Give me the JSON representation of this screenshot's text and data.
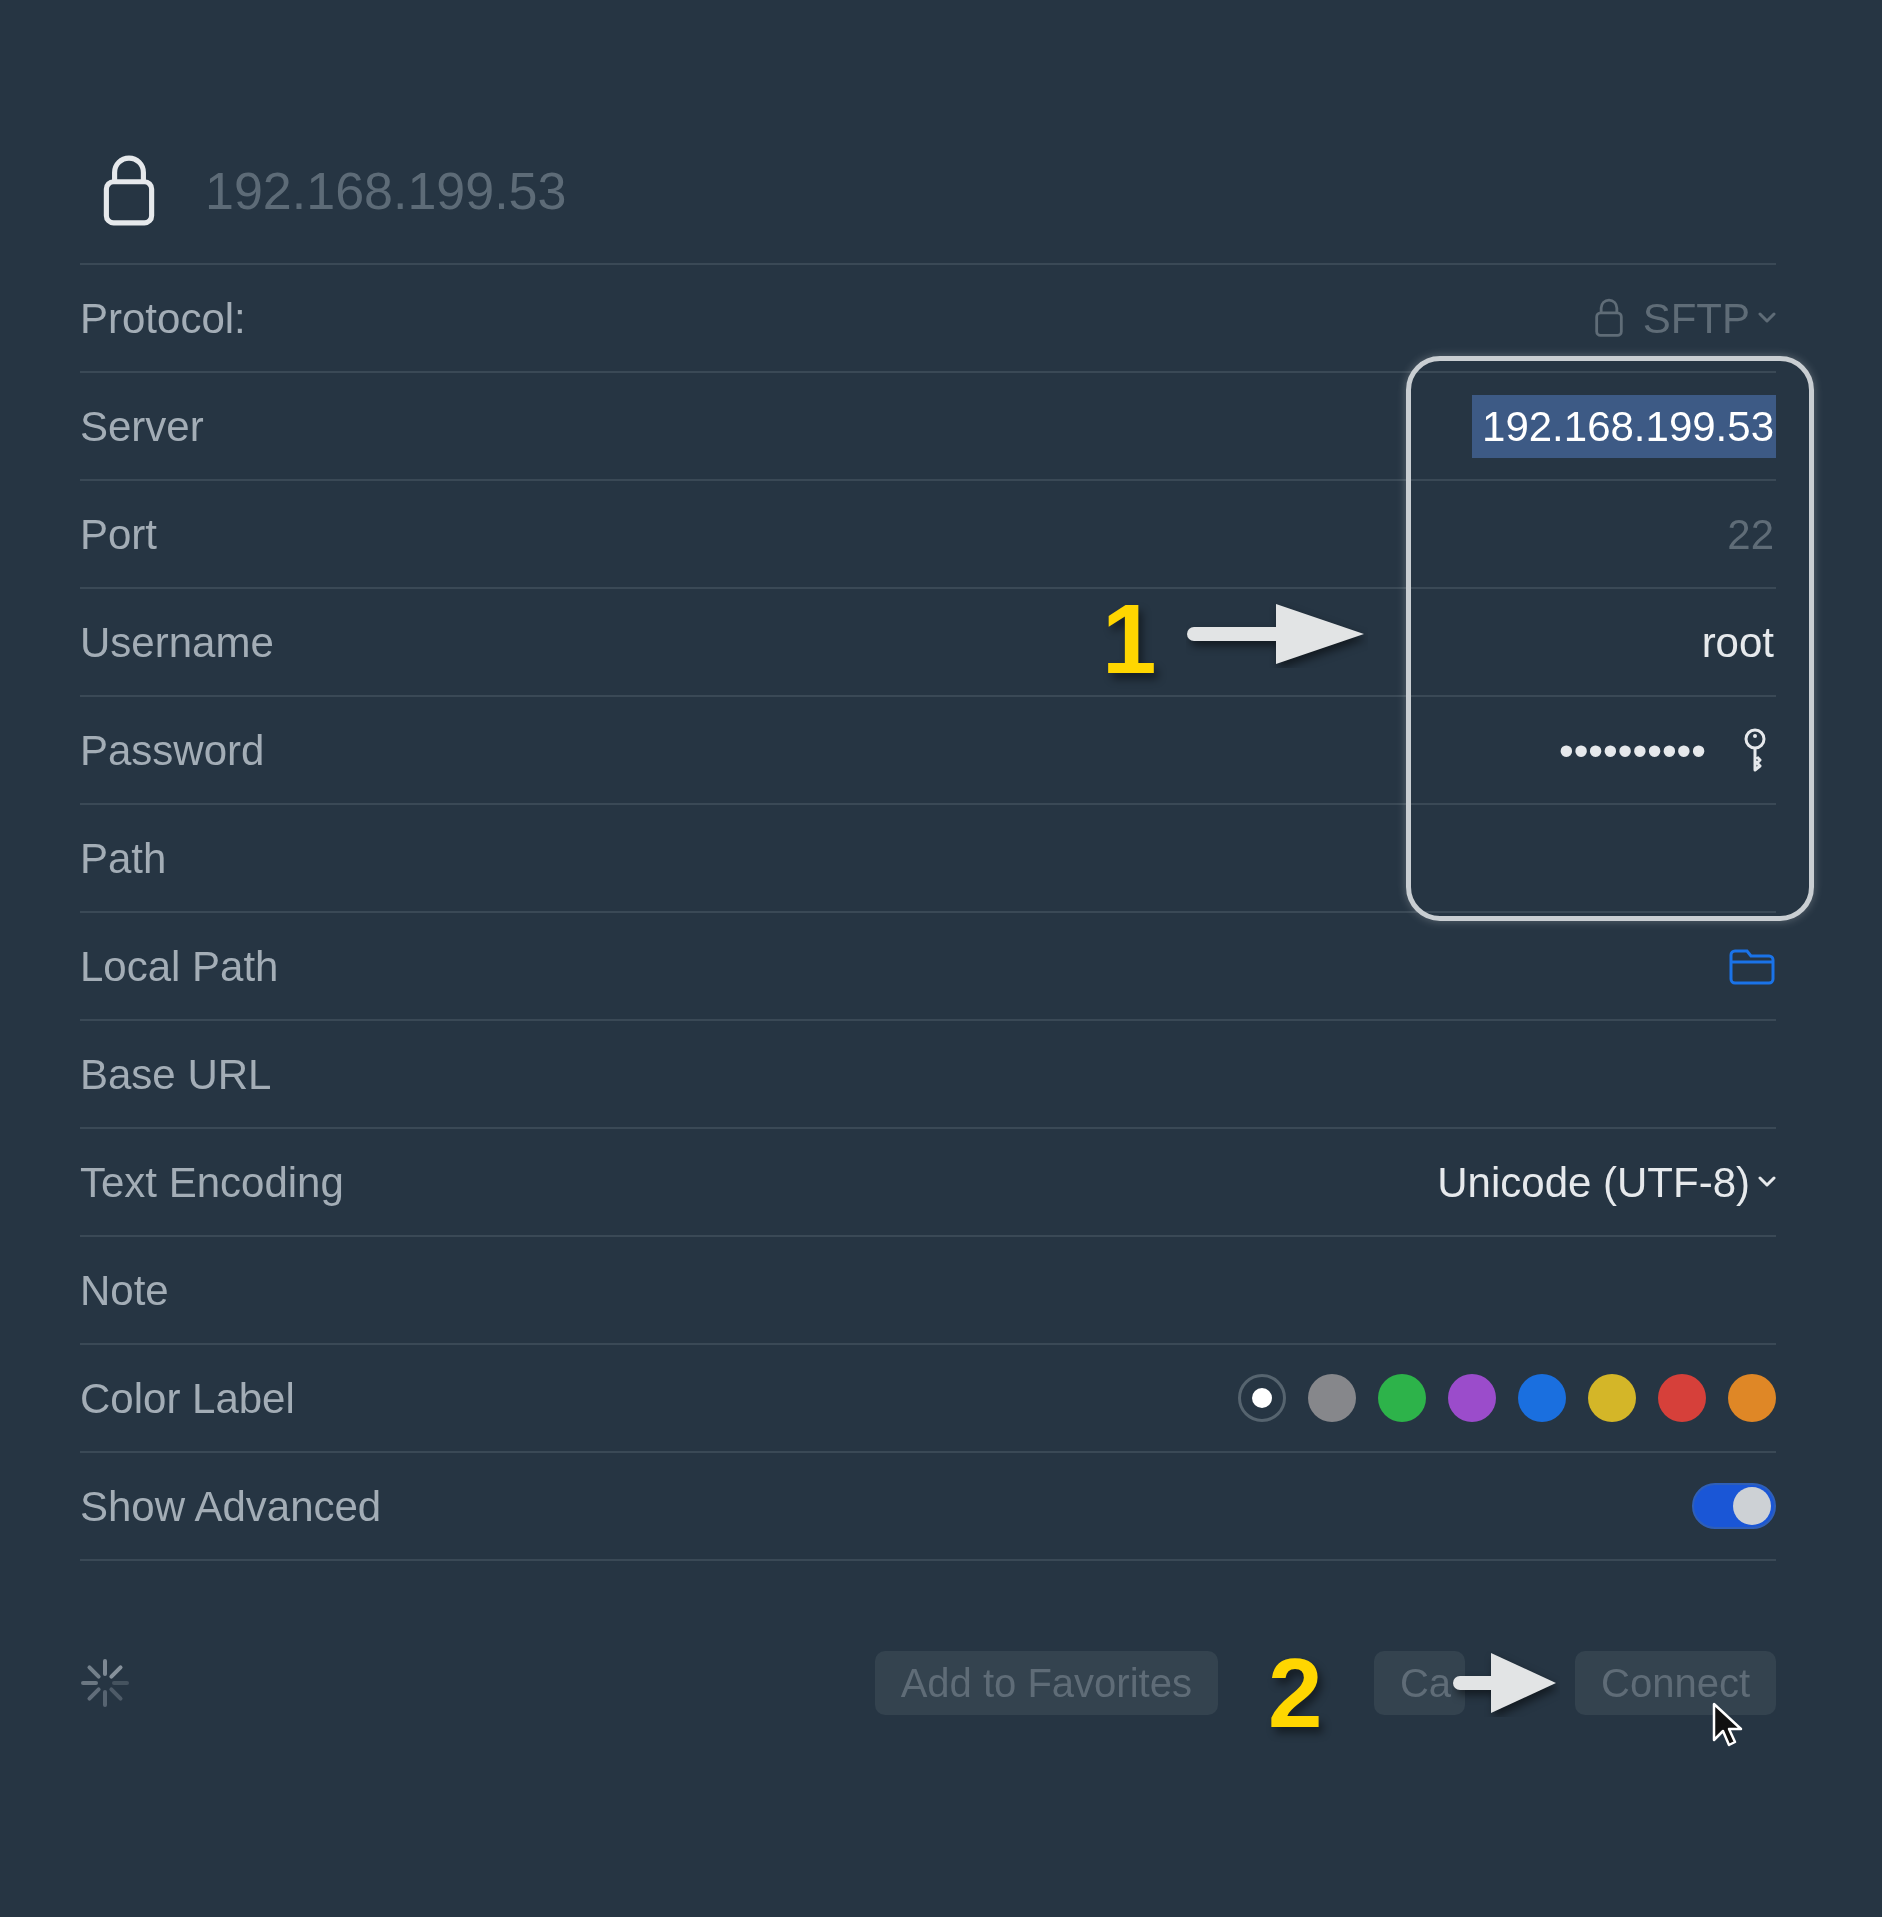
{
  "header": {
    "title": "192.168.199.53"
  },
  "fields": [
    {
      "kind": "dropdown",
      "label": "Protocol:",
      "value": "SFTP",
      "disabled": true
    },
    {
      "kind": "text",
      "label": "Server",
      "value": "192.168.199.53",
      "selected": true
    },
    {
      "kind": "text",
      "label": "Port",
      "placeholder": "22"
    },
    {
      "kind": "text",
      "label": "Username",
      "value": "root"
    },
    {
      "kind": "password",
      "label": "Password",
      "value": "••••••••••"
    },
    {
      "kind": "text",
      "label": "Path"
    },
    {
      "kind": "folder",
      "label": "Local Path"
    },
    {
      "kind": "text",
      "label": "Base URL"
    },
    {
      "kind": "dropdown",
      "label": "Text Encoding",
      "value": "Unicode (UTF-8)",
      "disabled": false
    },
    {
      "kind": "text",
      "label": "Note"
    },
    {
      "kind": "colors",
      "label": "Color Label",
      "options": [
        {
          "selected": true
        },
        {
          "color": "#86878b",
          "selected": false
        },
        {
          "color": "#2db34a",
          "selected": false
        },
        {
          "color": "#9b4ccb",
          "selected": false
        },
        {
          "color": "#1a6fdf",
          "selected": false
        },
        {
          "color": "#d4b628",
          "selected": false
        },
        {
          "color": "#d6403a",
          "selected": false
        },
        {
          "color": "#df8726",
          "selected": false
        }
      ]
    },
    {
      "kind": "switch",
      "label": "Show Advanced",
      "on": true
    }
  ],
  "footer": {
    "loading": true,
    "buttons": [
      {
        "label": "Add to Favorites",
        "disabled": true
      },
      {
        "label": "Ca",
        "disabled": true
      },
      {
        "label": "Connect",
        "disabled": true
      }
    ]
  },
  "annotations": [
    {
      "text": "1"
    },
    {
      "text": "2"
    }
  ]
}
